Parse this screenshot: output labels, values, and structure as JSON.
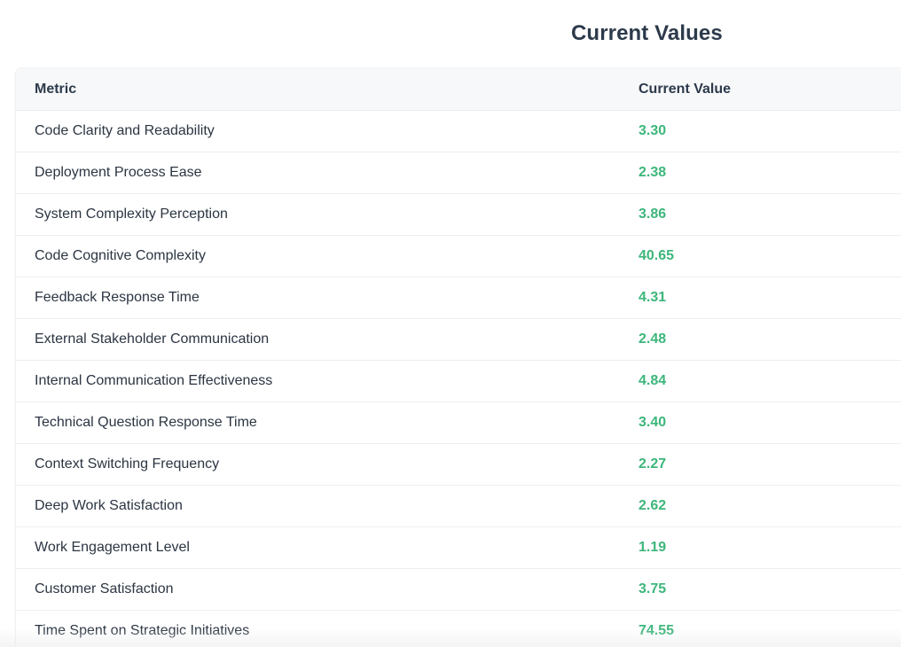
{
  "page": {
    "title": "Current Values"
  },
  "table": {
    "columns": [
      "Metric",
      "Current Value"
    ],
    "rows": [
      {
        "metric": "Code Clarity and Readability",
        "value": "3.30"
      },
      {
        "metric": "Deployment Process Ease",
        "value": "2.38"
      },
      {
        "metric": "System Complexity Perception",
        "value": "3.86"
      },
      {
        "metric": "Code Cognitive Complexity",
        "value": "40.65"
      },
      {
        "metric": "Feedback Response Time",
        "value": "4.31"
      },
      {
        "metric": "External Stakeholder Communication",
        "value": "2.48"
      },
      {
        "metric": "Internal Communication Effectiveness",
        "value": "4.84"
      },
      {
        "metric": "Technical Question Response Time",
        "value": "3.40"
      },
      {
        "metric": "Context Switching Frequency",
        "value": "2.27"
      },
      {
        "metric": "Deep Work Satisfaction",
        "value": "2.62"
      },
      {
        "metric": "Work Engagement Level",
        "value": "1.19"
      },
      {
        "metric": "Customer Satisfaction",
        "value": "3.75"
      },
      {
        "metric": "Time Spent on Strategic Initiatives",
        "value": "74.55"
      }
    ]
  },
  "colors": {
    "value_text": "#3db67b",
    "heading_text": "#2c3a4b",
    "header_background": "#f7f8fa"
  }
}
